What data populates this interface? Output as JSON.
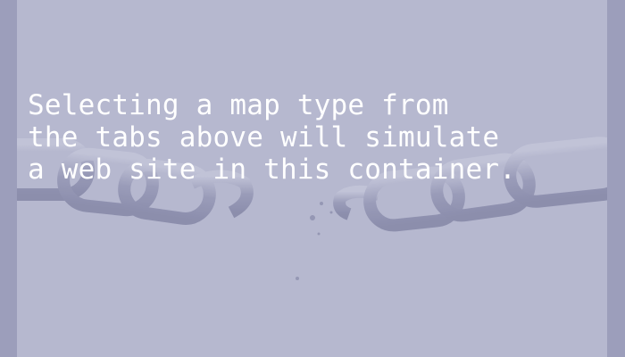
{
  "container": {
    "message_lines": [
      "Selecting a map type from",
      "the tabs above will simulate",
      "a web site in this container."
    ],
    "background_image": "broken-chain-icon"
  },
  "colors": {
    "outer_frame": "#9c9ebb",
    "container_background": "#b6b8cf",
    "message_text": "#ffffff",
    "chain_tint": "#9294b3"
  }
}
